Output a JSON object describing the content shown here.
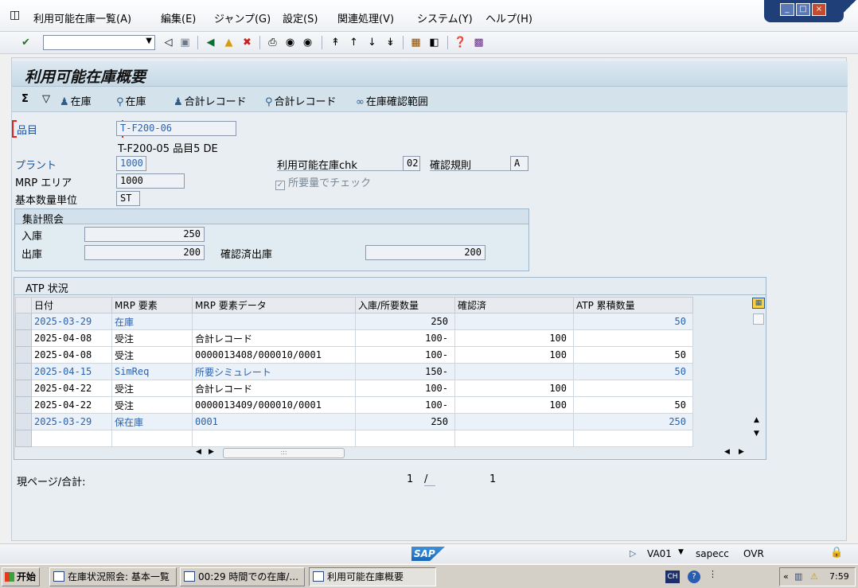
{
  "menu": {
    "items": [
      "利用可能在庫一覧(A)",
      "編集(E)",
      "ジャンプ(G)",
      "設定(S)",
      "関連処理(V)",
      "システム(Y)",
      "ヘルプ(H)"
    ]
  },
  "toolbar": {
    "command_value": ""
  },
  "screen": {
    "title": "利用可能在庫概要"
  },
  "app_toolbar": {
    "items": [
      "在庫",
      "在庫",
      "合計レコード",
      "合計レコード",
      "在庫確認範囲"
    ]
  },
  "header": {
    "material_label": "品目",
    "material_value": "T-F200-06",
    "material_desc": "T-F200-05  品目5 DE",
    "plant_label": "プラント",
    "plant_value": "1000",
    "mrp_area_label": "MRP エリア",
    "mrp_area_value": "1000",
    "base_unit_label": "基本数量単位",
    "base_unit_value": "ST",
    "chk_label": "利用可能在庫chk",
    "chk_value": "02",
    "rule_label": "確認規則",
    "rule_value": "A",
    "req_check_label": "所要量でチェック",
    "req_check_checked": true
  },
  "totals": {
    "title": "集計照会",
    "receipts_label": "入庫",
    "receipts_value": "250",
    "issues_label": "出庫",
    "issues_value": "200",
    "confirmed_label": "確認済出庫",
    "confirmed_value": "200"
  },
  "atp": {
    "title": "ATP 状況",
    "columns": [
      "日付",
      "MRP 要素",
      "MRP 要素データ",
      "入庫/所要数量",
      "確認済",
      "ATP 累積数量"
    ],
    "rows": [
      {
        "date": "2025-03-29",
        "element": "在庫",
        "data": "",
        "qty": "250",
        "confirmed": "",
        "cum": "50",
        "blue": true
      },
      {
        "date": "2025-04-08",
        "element": "受注",
        "data": "合計レコード",
        "qty": "100-",
        "confirmed": "100",
        "cum": "",
        "blue": false
      },
      {
        "date": "2025-04-08",
        "element": "受注",
        "data": "0000013408/000010/0001",
        "qty": "100-",
        "confirmed": "100",
        "cum": "50",
        "blue": false
      },
      {
        "date": "2025-04-15",
        "element": "SimReq",
        "data": "所要シミュレート",
        "qty": "150-",
        "confirmed": "",
        "cum": "50",
        "blue": true
      },
      {
        "date": "2025-04-22",
        "element": "受注",
        "data": "合計レコード",
        "qty": "100-",
        "confirmed": "100",
        "cum": "",
        "blue": false
      },
      {
        "date": "2025-04-22",
        "element": "受注",
        "data": "0000013409/000010/0001",
        "qty": "100-",
        "confirmed": "100",
        "cum": "50",
        "blue": false
      },
      {
        "date": "2025-03-29",
        "element": "保在庫",
        "data": "0001",
        "qty": "250",
        "confirmed": "",
        "cum": "250",
        "blue": true
      }
    ]
  },
  "paging": {
    "label": "現ページ/合計:",
    "current": "1",
    "separator": "/",
    "total": "1"
  },
  "status": {
    "logo": "SAP",
    "transaction": "VA01",
    "server": "sapecc",
    "mode": "OVR"
  },
  "taskbar": {
    "start": "开始",
    "tasks": [
      "在庫状況照会: 基本一覧",
      "00:29 時間での在庫/...",
      "利用可能在庫概要"
    ],
    "lang": "CH",
    "clock": "7:59"
  }
}
